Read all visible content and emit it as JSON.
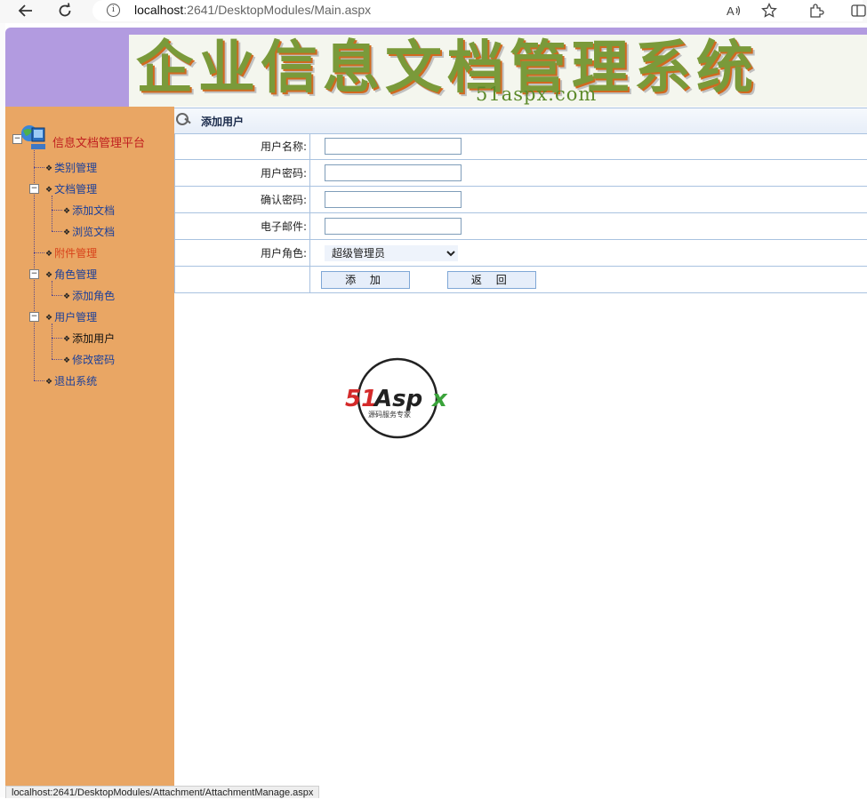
{
  "browser": {
    "url_host": "localhost",
    "url_rest": ":2641/DesktopModules/Main.aspx"
  },
  "banner": {
    "title": "企业信息文档管理系统",
    "subtitle": "51aspx.com"
  },
  "sidebar": {
    "root": "信息文档管理平台",
    "items": [
      {
        "label": "类别管理"
      },
      {
        "label": "文档管理"
      },
      {
        "label": "添加文档"
      },
      {
        "label": "浏览文档"
      },
      {
        "label": "附件管理"
      },
      {
        "label": "角色管理"
      },
      {
        "label": "添加角色"
      },
      {
        "label": "用户管理"
      },
      {
        "label": "添加用户"
      },
      {
        "label": "修改密码"
      },
      {
        "label": "退出系统"
      }
    ]
  },
  "form": {
    "header": "添加用户",
    "fields": [
      {
        "label": "用户名称:",
        "value": ""
      },
      {
        "label": "用户密码:",
        "value": ""
      },
      {
        "label": "确认密码:",
        "value": ""
      },
      {
        "label": "电子邮件:",
        "value": ""
      },
      {
        "label": "用户角色:",
        "value": "超级管理员"
      }
    ],
    "add_button": "添 加",
    "back_button": "返 回"
  },
  "logo": {
    "brand": "51Aspx",
    "tagline": "源码服务专家"
  },
  "status_bar": {
    "text": "localhost:2641/DesktopModules/Attachment/AttachmentManage.aspx"
  },
  "colors": {
    "sidebar_bg": "#e9a664",
    "banner_purple": "#b29be0",
    "link_blue": "#1a3f9a",
    "root_red": "#c01f1f",
    "active_orange": "#d8421a",
    "form_border": "#a9c2e0"
  }
}
